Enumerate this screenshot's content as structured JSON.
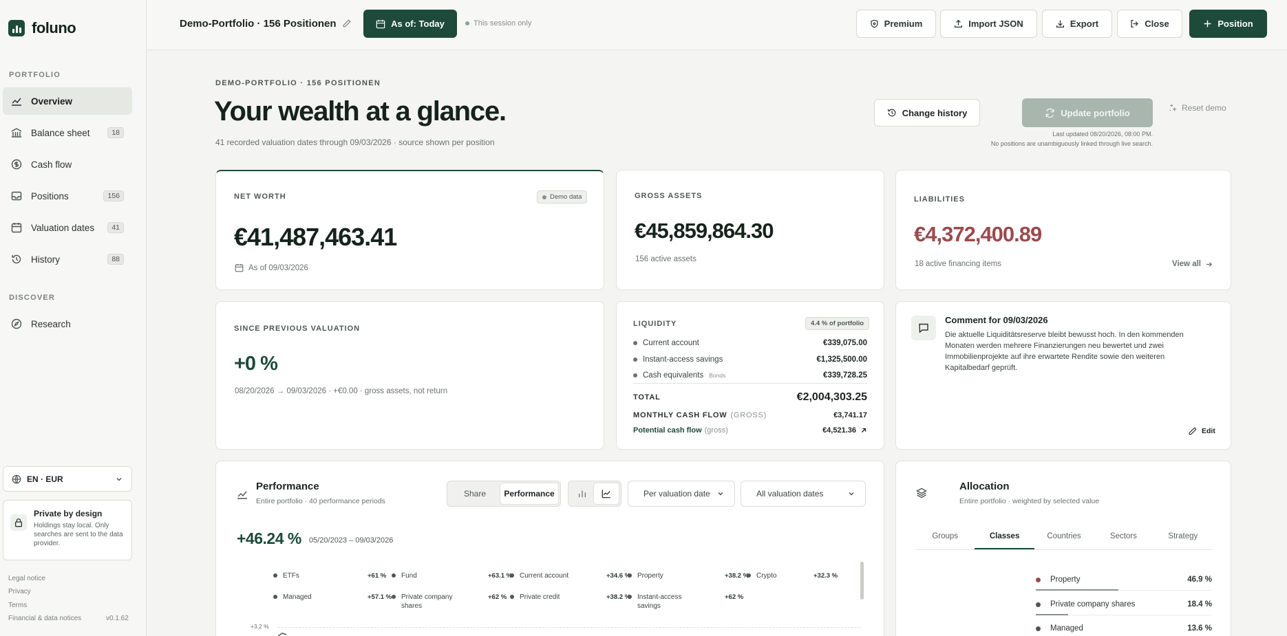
{
  "app": {
    "logo": "foluno"
  },
  "sidebar": {
    "portfolio_heading": "PORTFOLIO",
    "discover_heading": "DISCOVER",
    "items": [
      {
        "label": "Overview",
        "icon": "chart-line-icon",
        "badge": ""
      },
      {
        "label": "Balance sheet",
        "icon": "bank-icon",
        "badge": "18"
      },
      {
        "label": "Cash flow",
        "icon": "dollar-circle-icon",
        "badge": ""
      },
      {
        "label": "Positions",
        "icon": "inbox-icon",
        "badge": "156"
      },
      {
        "label": "Valuation dates",
        "icon": "calendar-icon",
        "badge": "41"
      },
      {
        "label": "History",
        "icon": "history-icon",
        "badge": "88"
      }
    ],
    "discover_items": [
      {
        "label": "Research",
        "icon": "compass-icon"
      }
    ],
    "language": "EN · EUR",
    "privacy": {
      "title": "Private by design",
      "text": "Holdings stay local. Only searches are sent to the data provider."
    },
    "footer": {
      "legal": "Legal notice",
      "privacy": "Privacy",
      "terms": "Terms",
      "notices": "Financial & data notices",
      "version": "v0.1.62"
    }
  },
  "topbar": {
    "portfolio_name": "Demo-Portfolio · 156 Positionen",
    "asof": "As of: Today",
    "session": "This session only",
    "premium": "Premium",
    "import": "Import JSON",
    "export": "Export",
    "close": "Close",
    "position": "Position"
  },
  "header": {
    "eyebrow": "DEMO-PORTFOLIO · 156 POSITIONEN",
    "title": "Your wealth at a glance.",
    "subtitle": "41 recorded valuation dates through 09/03/2026 · source shown per position",
    "change_history": "Change history",
    "update": "Update portfolio",
    "reset": "Reset demo",
    "last_updated": "Last updated 08/20/2026, 08:00 PM.",
    "no_positions": "No positions are unambiguously linked through live search."
  },
  "net_worth": {
    "label": "NET WORTH",
    "badge": "Demo data",
    "value": "€41,487,463.41",
    "asof": "As of 09/03/2026"
  },
  "gross_assets": {
    "label": "GROSS ASSETS",
    "value": "€45,859,864.30",
    "note": "156 active assets"
  },
  "liabilities": {
    "label": "LIABILITIES",
    "value": "€4,372,400.89",
    "note": "18 active financing items",
    "link": "View all",
    "color": "#9a4a4e"
  },
  "since_prev": {
    "label": "SINCE PREVIOUS VALUATION",
    "value": "+0 %",
    "note": "08/20/2026 → 09/03/2026 · +€0.00 · gross assets, not return",
    "color": "#1d4a3a"
  },
  "liquidity": {
    "label": "LIQUIDITY",
    "badge": "4.4 % of portfolio",
    "rows": [
      {
        "label": "Current account",
        "tag": "",
        "value": "€339,075.00"
      },
      {
        "label": "Instant-access savings",
        "tag": "",
        "value": "€1,325,500.00"
      },
      {
        "label": "Cash equivalents",
        "tag": "Bonds",
        "value": "€339,728.25"
      }
    ],
    "total_label": "TOTAL",
    "total_value": "€2,004,303.25",
    "monthly_label": "MONTHLY CASH FLOW",
    "monthly_suffix": "(GROSS)",
    "monthly_value": "€3,741.17",
    "potential_label": "Potential cash flow",
    "potential_suffix": "(gross)",
    "potential_value": "€4,521.36"
  },
  "comment": {
    "title": "Comment for 09/03/2026",
    "text": "Die aktuelle Liquiditätsreserve bleibt bewusst hoch. In den kommenden Monaten werden mehrere Finanzierungen neu bewertet und zwei Immobilienprojekte auf ihre erwartete Rendite sowie den weiteren Kapitalbedarf geprüft.",
    "edit": "Edit"
  },
  "performance": {
    "title": "Performance",
    "subtitle": "Entire portfolio · 40 performance periods",
    "toggle_share": "Share",
    "toggle_performance": "Performance",
    "per_valuation": "Per valuation date",
    "all_dates": "All valuation dates",
    "value": "+46.24 %",
    "range": "05/20/2023 – 09/03/2026",
    "y_tick": "+3.2 %",
    "legend": [
      {
        "label": "ETFs",
        "pct": "+61 %"
      },
      {
        "label": "Fund",
        "pct": "+63.1 %"
      },
      {
        "label": "Current account",
        "pct": "+34.6 %"
      },
      {
        "label": "Property",
        "pct": "+38.2 %"
      },
      {
        "label": "Crypto",
        "pct": "+32.3 %"
      },
      {
        "label": "Managed",
        "pct": "+57.1 %"
      },
      {
        "label": "Private company shares",
        "pct": "+62 %"
      },
      {
        "label": "Private credit",
        "pct": "+38.2 %"
      },
      {
        "label": "Instant-access savings",
        "pct": "+62 %"
      }
    ]
  },
  "allocation": {
    "title": "Allocation",
    "subtitle": "Entire portfolio · weighted by selected value",
    "tabs": [
      "Groups",
      "Classes",
      "Countries",
      "Sectors",
      "Strategy"
    ],
    "rows": [
      {
        "label": "Property",
        "value": "46.9 %",
        "share": 0.469,
        "color": "#9a4a4e"
      },
      {
        "label": "Private company shares",
        "value": "18.4 %",
        "share": 0.184,
        "color": "#4e5752"
      },
      {
        "label": "Managed",
        "value": "13.6 %",
        "share": 0.136,
        "color": "#4e5752"
      }
    ]
  }
}
